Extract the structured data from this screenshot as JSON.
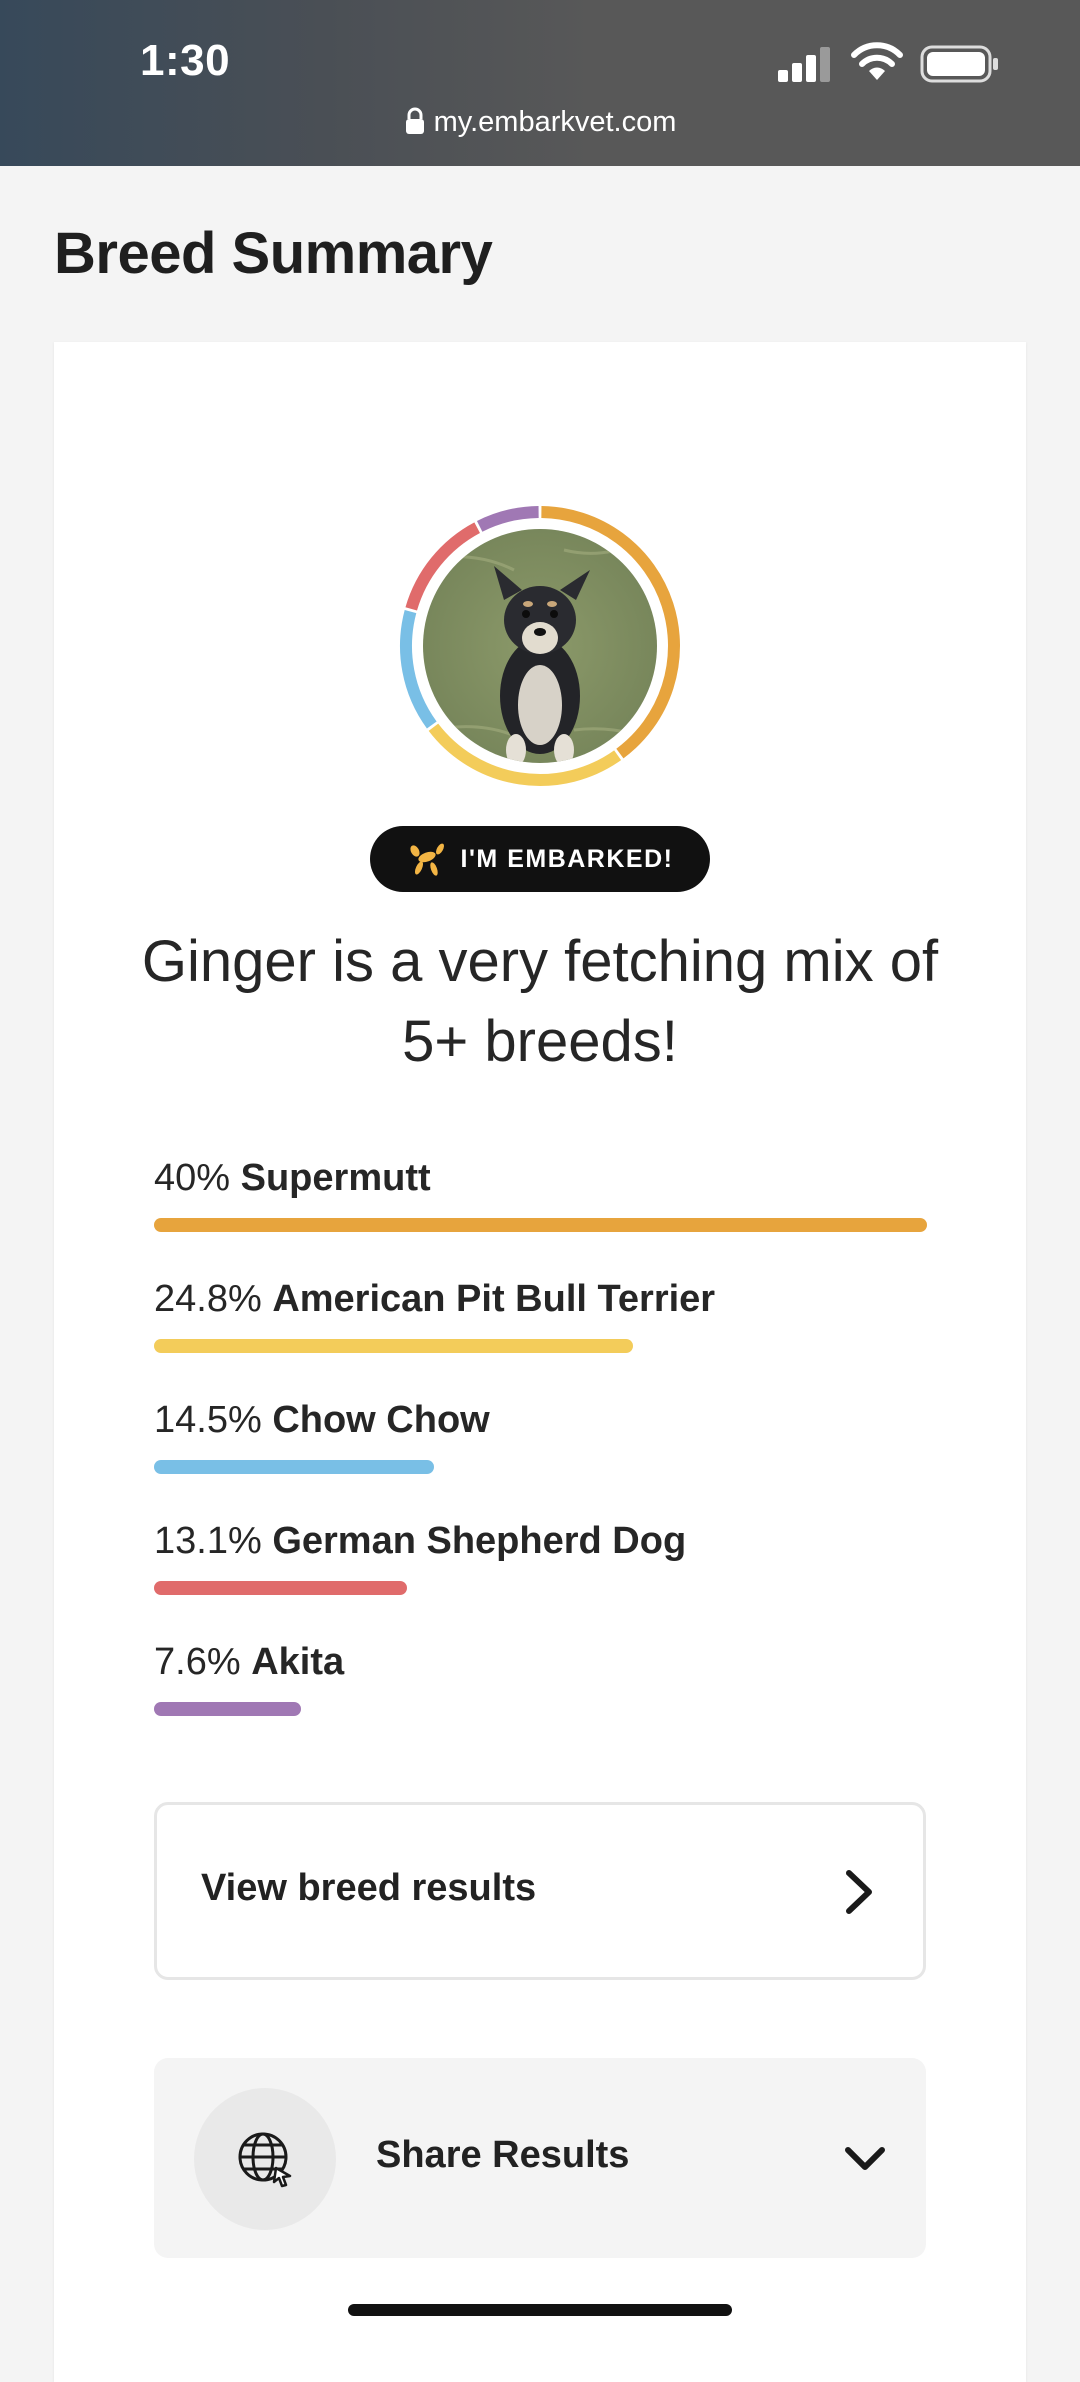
{
  "status_bar": {
    "time": "1:30",
    "url": "my.embarkvet.com"
  },
  "page": {
    "title": "Breed Summary"
  },
  "summary": {
    "badge_label": "I'M EMBARKED!",
    "headline": "Ginger is a very fetching mix of 5+ breeds!",
    "breeds": [
      {
        "pct": "40%",
        "name": "Supermutt",
        "fraction": 0.4,
        "color": "#e7a43d"
      },
      {
        "pct": "24.8%",
        "name": "American Pit Bull Terrier",
        "fraction": 0.248,
        "color": "#f3cc5a"
      },
      {
        "pct": "14.5%",
        "name": "Chow Chow",
        "fraction": 0.145,
        "color": "#79bfe6"
      },
      {
        "pct": "13.1%",
        "name": "German Shepherd Dog",
        "fraction": 0.131,
        "color": "#e06b6b"
      },
      {
        "pct": "7.6%",
        "name": "Akita",
        "fraction": 0.076,
        "color": "#a078b4"
      }
    ],
    "view_button_label": "View breed results",
    "share_label": "Share Results"
  }
}
